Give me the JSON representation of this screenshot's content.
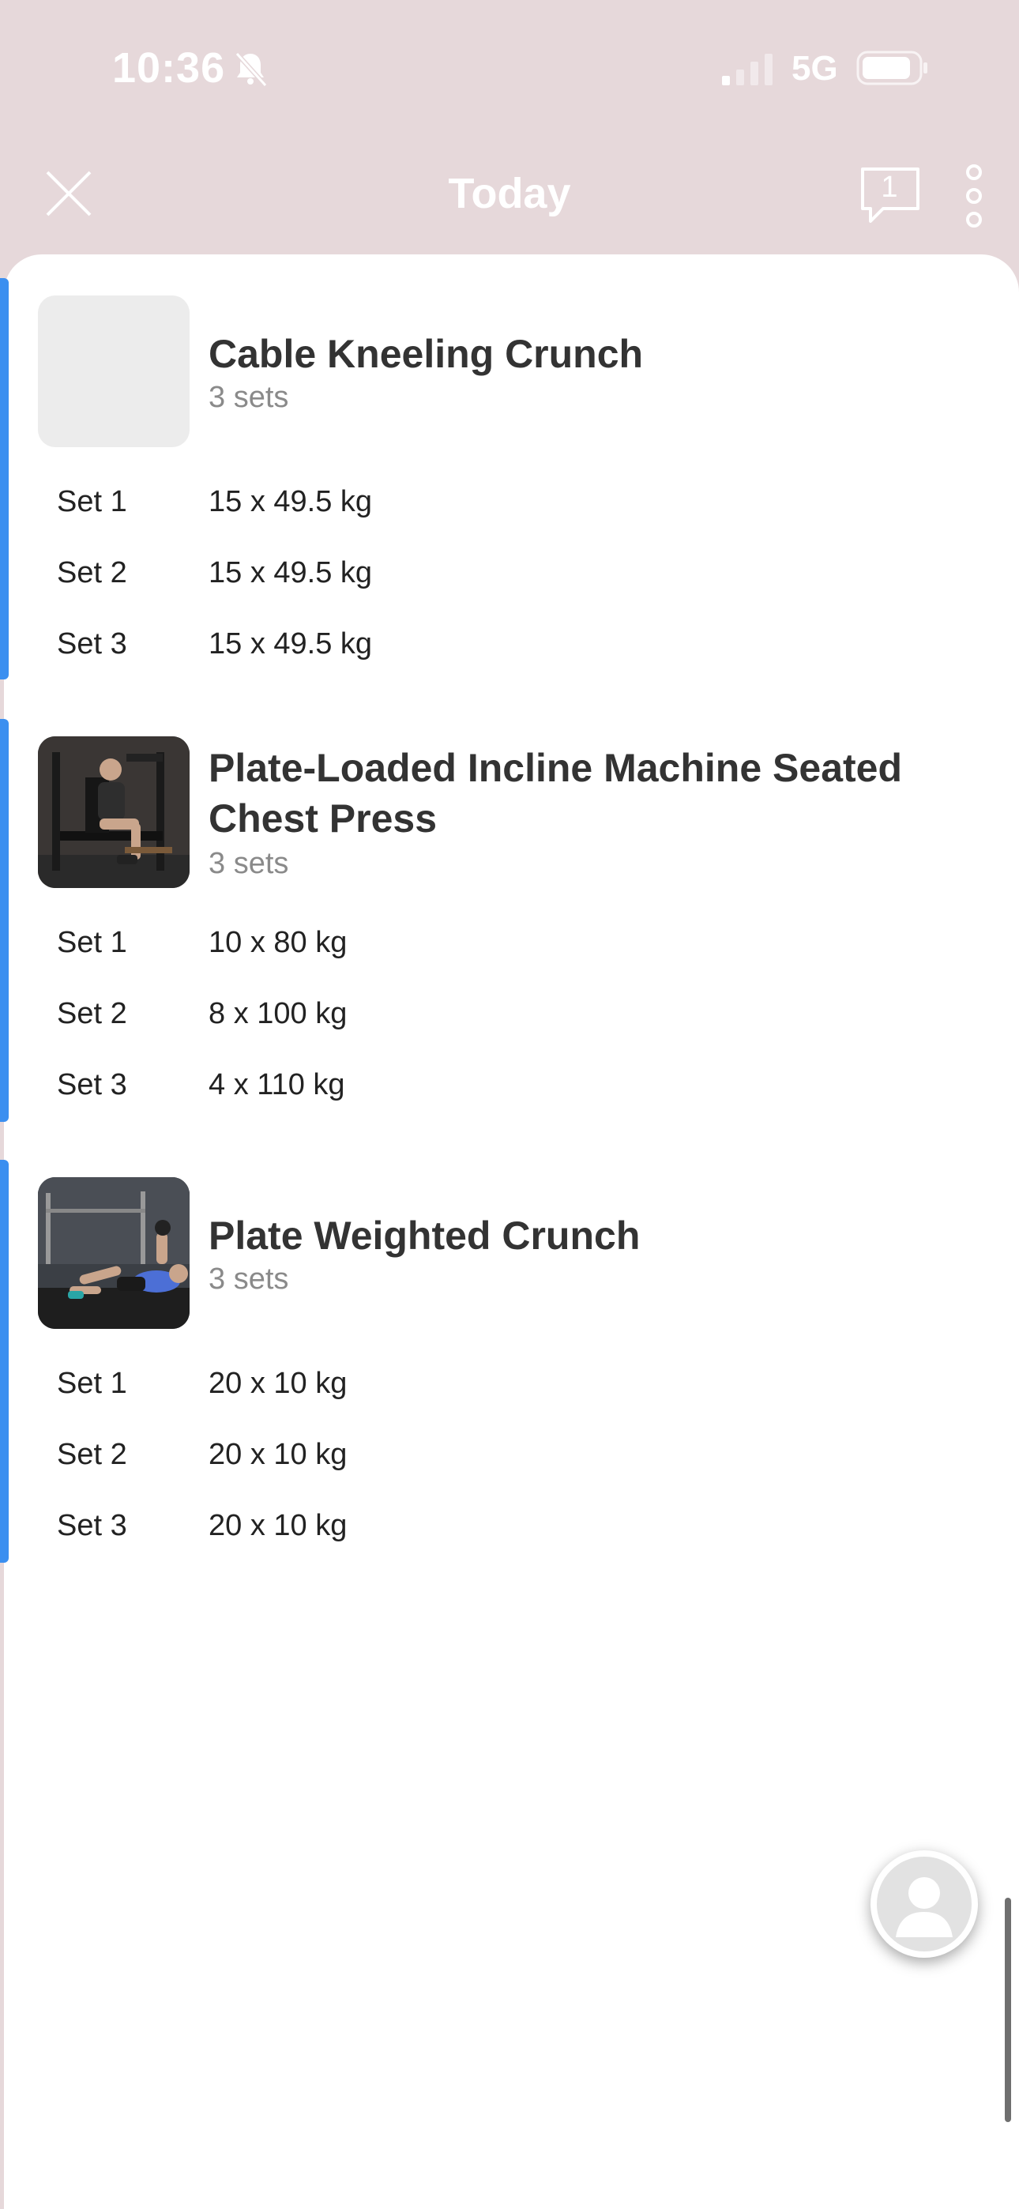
{
  "status_bar": {
    "time": "10:36",
    "network": "5G"
  },
  "nav": {
    "title": "Today",
    "comment_count": "1"
  },
  "exercises": [
    {
      "title": "Cable Kneeling Crunch",
      "sets_summary": "3 sets",
      "sets": [
        {
          "label": "Set 1",
          "value": "15 x 49.5 kg"
        },
        {
          "label": "Set 2",
          "value": "15 x 49.5 kg"
        },
        {
          "label": "Set 3",
          "value": "15 x 49.5 kg"
        }
      ]
    },
    {
      "title": "Plate-Loaded Incline Machine Seated Chest Press",
      "sets_summary": "3 sets",
      "sets": [
        {
          "label": "Set 1",
          "value": "10 x 80 kg"
        },
        {
          "label": "Set 2",
          "value": "8 x 100 kg"
        },
        {
          "label": "Set 3",
          "value": "4 x 110 kg"
        }
      ]
    },
    {
      "title": "Plate Weighted Crunch",
      "sets_summary": "3 sets",
      "sets": [
        {
          "label": "Set 1",
          "value": "20 x 10 kg"
        },
        {
          "label": "Set 2",
          "value": "20 x 10 kg"
        },
        {
          "label": "Set 3",
          "value": "20 x 10 kg"
        }
      ]
    }
  ],
  "colors": {
    "accent": "#3b8ff0",
    "header_bg": "#e6d8da"
  },
  "icons": [
    "bell-slash-icon",
    "signal-icon",
    "battery-icon",
    "close-icon",
    "comment-icon",
    "more-vertical-icon",
    "avatar-icon"
  ]
}
